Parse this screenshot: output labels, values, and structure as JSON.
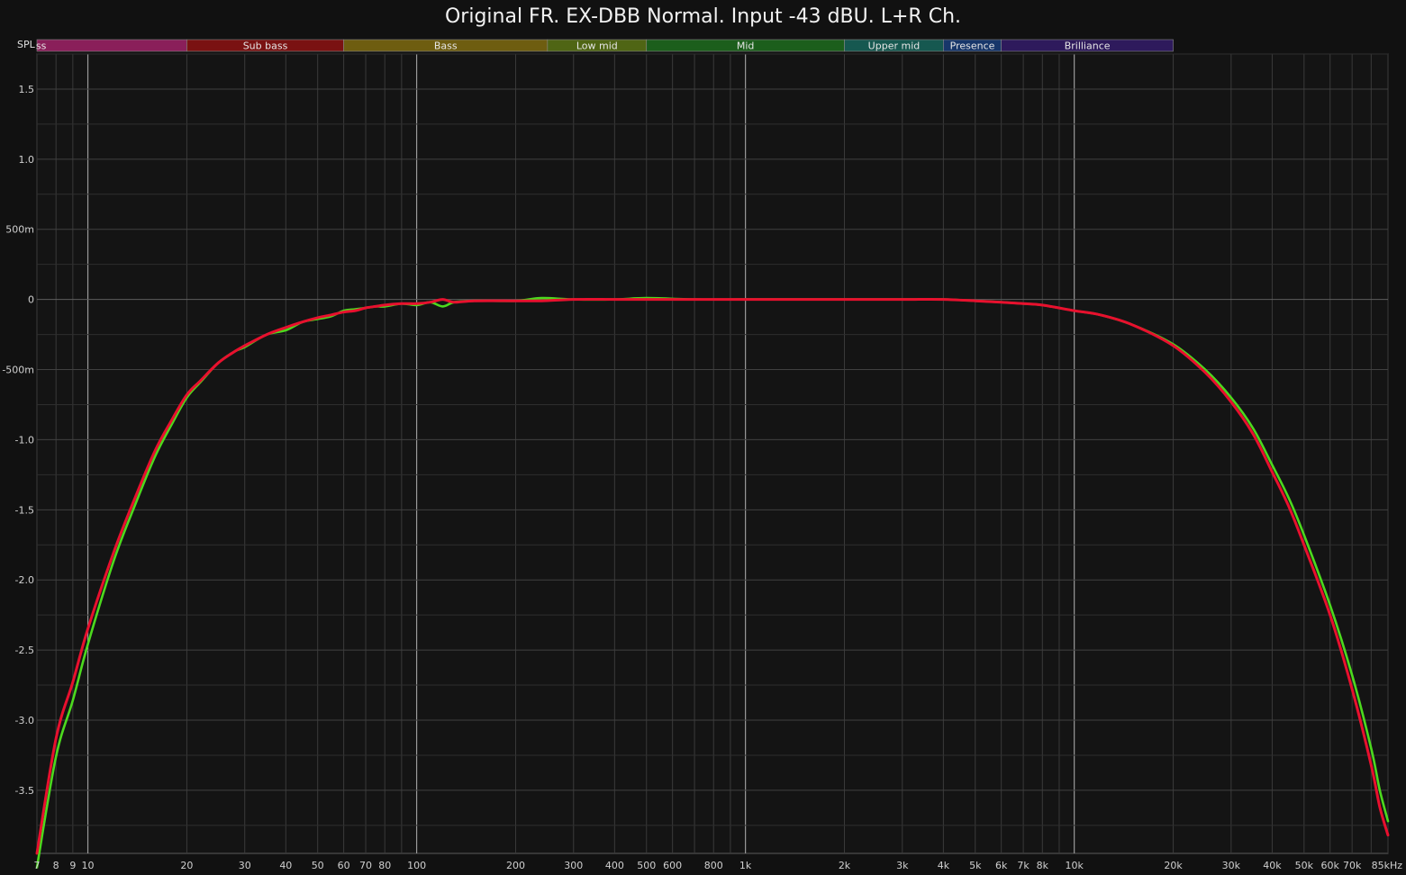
{
  "chart_data": {
    "type": "line",
    "title": "Original FR. EX-DBB Normal. Input -43 dBU. L+R Ch.",
    "y_axis_name": "SPL",
    "x_scale": "log",
    "xlim": [
      7,
      90000
    ],
    "ylim": [
      -3.95,
      1.75
    ],
    "grid": true,
    "x_ticks": [
      {
        "v": 7,
        "label": "7"
      },
      {
        "v": 8,
        "label": "8"
      },
      {
        "v": 9,
        "label": "9"
      },
      {
        "v": 10,
        "label": "10"
      },
      {
        "v": 20,
        "label": "20"
      },
      {
        "v": 30,
        "label": "30"
      },
      {
        "v": 40,
        "label": "40"
      },
      {
        "v": 50,
        "label": "50"
      },
      {
        "v": 60,
        "label": "60"
      },
      {
        "v": 70,
        "label": "70"
      },
      {
        "v": 80,
        "label": "80"
      },
      {
        "v": 100,
        "label": "100"
      },
      {
        "v": 200,
        "label": "200"
      },
      {
        "v": 300,
        "label": "300"
      },
      {
        "v": 400,
        "label": "400"
      },
      {
        "v": 500,
        "label": "500"
      },
      {
        "v": 600,
        "label": "600"
      },
      {
        "v": 800,
        "label": "800"
      },
      {
        "v": 1000,
        "label": "1k"
      },
      {
        "v": 2000,
        "label": "2k"
      },
      {
        "v": 3000,
        "label": "3k"
      },
      {
        "v": 4000,
        "label": "4k"
      },
      {
        "v": 5000,
        "label": "5k"
      },
      {
        "v": 6000,
        "label": "6k"
      },
      {
        "v": 7000,
        "label": "7k"
      },
      {
        "v": 8000,
        "label": "8k"
      },
      {
        "v": 10000,
        "label": "10k"
      },
      {
        "v": 20000,
        "label": "20k"
      },
      {
        "v": 30000,
        "label": "30k"
      },
      {
        "v": 40000,
        "label": "40k"
      },
      {
        "v": 50000,
        "label": "50k"
      },
      {
        "v": 60000,
        "label": "60k"
      },
      {
        "v": 70000,
        "label": "70k"
      },
      {
        "v": 85000,
        "label": "85kHz"
      }
    ],
    "y_ticks": [
      {
        "v": 1.5,
        "label": "1.5"
      },
      {
        "v": 1.0,
        "label": "1.0"
      },
      {
        "v": 0.5,
        "label": "500m"
      },
      {
        "v": 0,
        "label": "0"
      },
      {
        "v": -0.5,
        "label": "-500m"
      },
      {
        "v": -1.0,
        "label": "-1.0"
      },
      {
        "v": -1.5,
        "label": "-1.5"
      },
      {
        "v": -2.0,
        "label": "-2.0"
      },
      {
        "v": -2.5,
        "label": "-2.5"
      },
      {
        "v": -3.0,
        "label": "-3.0"
      },
      {
        "v": -3.5,
        "label": "-3.5"
      }
    ],
    "bands": [
      {
        "label": "Low bass",
        "from": 7,
        "to": 20,
        "color": "#8a1f5a"
      },
      {
        "label": "Sub bass",
        "from": 20,
        "to": 60,
        "color": "#7a1212"
      },
      {
        "label": "Bass",
        "from": 60,
        "to": 250,
        "color": "#6e5d10"
      },
      {
        "label": "Low mid",
        "from": 250,
        "to": 500,
        "color": "#4f6514"
      },
      {
        "label": "Mid",
        "from": 500,
        "to": 2000,
        "color": "#1c5e1c"
      },
      {
        "label": "Upper mid",
        "from": 2000,
        "to": 4000,
        "color": "#165850"
      },
      {
        "label": "Presence",
        "from": 4000,
        "to": 6000,
        "color": "#17366a"
      },
      {
        "label": "Brilliance",
        "from": 6000,
        "to": 20000,
        "color": "#2e1a5c"
      }
    ],
    "series": [
      {
        "color": "#4cd91e",
        "x": [
          7,
          8,
          9,
          10,
          12,
          14,
          16,
          18,
          20,
          22,
          25,
          28,
          30,
          35,
          40,
          45,
          50,
          55,
          60,
          65,
          70,
          75,
          80,
          90,
          100,
          110,
          120,
          130,
          150,
          200,
          240,
          300,
          400,
          500,
          700,
          1000,
          1500,
          2000,
          3000,
          4000,
          5000,
          6000,
          7000,
          8000,
          10000,
          12000,
          15000,
          20000,
          25000,
          30000,
          35000,
          40000,
          45000,
          50000,
          60000,
          70000,
          80000,
          85000,
          90000
        ],
        "y": [
          -4.05,
          -3.26,
          -2.86,
          -2.46,
          -1.86,
          -1.45,
          -1.12,
          -0.89,
          -0.7,
          -0.59,
          -0.45,
          -0.37,
          -0.34,
          -0.25,
          -0.22,
          -0.16,
          -0.14,
          -0.12,
          -0.08,
          -0.07,
          -0.06,
          -0.05,
          -0.05,
          -0.03,
          -0.04,
          -0.02,
          -0.05,
          -0.02,
          -0.01,
          -0.01,
          0.01,
          0.0,
          0.0,
          0.01,
          0.0,
          0.0,
          0.0,
          0.0,
          0.0,
          0.0,
          -0.01,
          -0.02,
          -0.03,
          -0.04,
          -0.08,
          -0.11,
          -0.18,
          -0.32,
          -0.5,
          -0.7,
          -0.92,
          -1.18,
          -1.42,
          -1.68,
          -2.18,
          -2.68,
          -3.2,
          -3.5,
          -3.72
        ]
      },
      {
        "color": "#e8102e",
        "x": [
          7,
          8,
          9,
          10,
          12,
          14,
          16,
          18,
          20,
          22,
          25,
          28,
          30,
          35,
          40,
          45,
          50,
          55,
          60,
          65,
          70,
          75,
          80,
          90,
          100,
          110,
          120,
          130,
          150,
          200,
          240,
          300,
          400,
          500,
          700,
          1000,
          1500,
          2000,
          3000,
          4000,
          5000,
          6000,
          7000,
          8000,
          10000,
          12000,
          15000,
          20000,
          25000,
          30000,
          35000,
          40000,
          45000,
          50000,
          60000,
          70000,
          80000,
          85000,
          90000
        ],
        "y": [
          -3.95,
          -3.13,
          -2.73,
          -2.35,
          -1.8,
          -1.4,
          -1.08,
          -0.86,
          -0.68,
          -0.58,
          -0.45,
          -0.37,
          -0.33,
          -0.25,
          -0.2,
          -0.16,
          -0.13,
          -0.11,
          -0.09,
          -0.08,
          -0.06,
          -0.05,
          -0.04,
          -0.03,
          -0.03,
          -0.02,
          0.0,
          -0.02,
          -0.01,
          -0.01,
          -0.01,
          0.0,
          0.0,
          0.0,
          0.0,
          0.0,
          0.0,
          0.0,
          0.0,
          0.0,
          -0.01,
          -0.02,
          -0.03,
          -0.04,
          -0.08,
          -0.11,
          -0.18,
          -0.33,
          -0.52,
          -0.73,
          -0.96,
          -1.23,
          -1.48,
          -1.75,
          -2.25,
          -2.78,
          -3.32,
          -3.62,
          -3.82
        ]
      }
    ]
  }
}
